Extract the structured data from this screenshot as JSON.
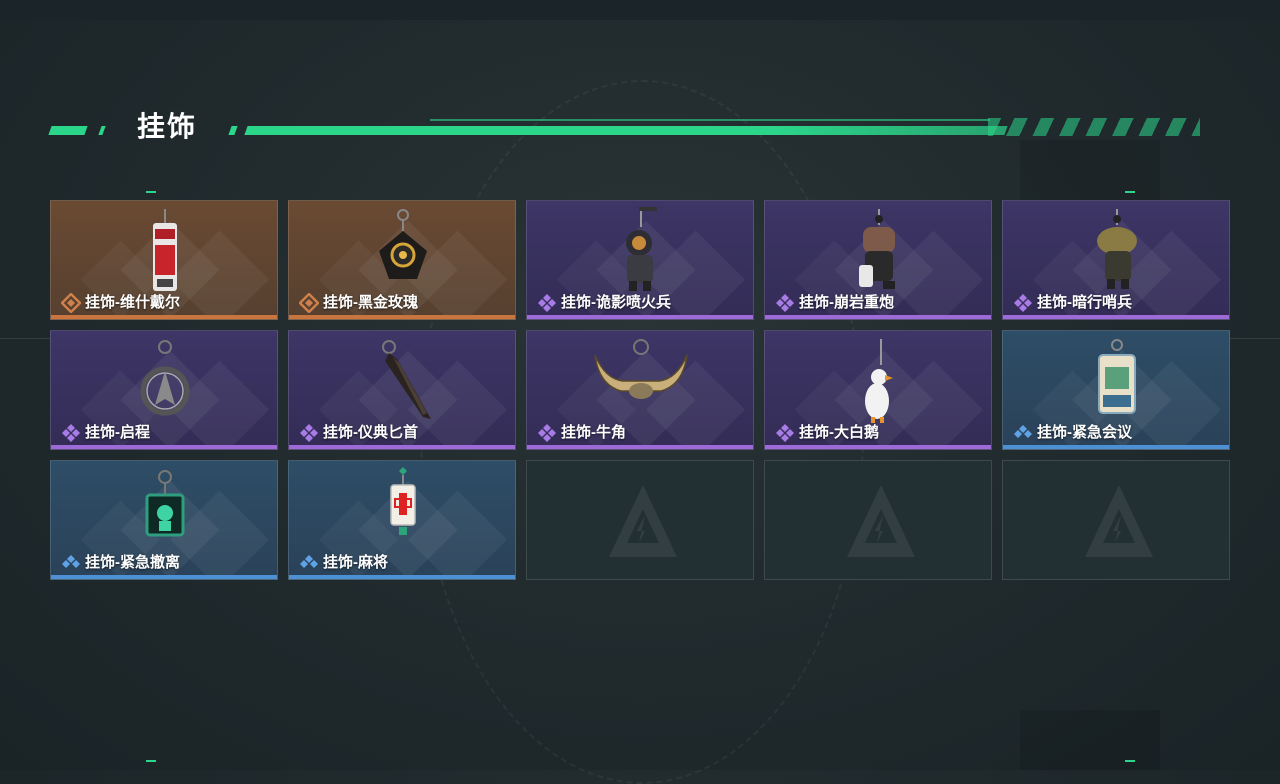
{
  "section": {
    "title": "挂饰"
  },
  "colors": {
    "accent": "#2bd58a",
    "orange_rarity": "#c9753f",
    "purple_rarity": "#9d6ad8",
    "blue_rarity": "#4d90d4"
  },
  "items": [
    {
      "label": "挂饰-维什戴尔",
      "rarity": "orange",
      "icon": "red-tag-charm-icon"
    },
    {
      "label": "挂饰-黑金玫瑰",
      "rarity": "orange",
      "icon": "black-gold-rose-charm-icon"
    },
    {
      "label": "挂饰-诡影喷火兵",
      "rarity": "purple",
      "icon": "flamethrower-figure-charm-icon"
    },
    {
      "label": "挂饰-崩岩重炮",
      "rarity": "purple",
      "icon": "heavy-gunner-figure-charm-icon"
    },
    {
      "label": "挂饰-暗行哨兵",
      "rarity": "purple",
      "icon": "sentry-figure-charm-icon"
    },
    {
      "label": "挂饰-启程",
      "rarity": "purple",
      "icon": "compass-ring-charm-icon"
    },
    {
      "label": "挂饰-仪典匕首",
      "rarity": "purple",
      "icon": "dagger-charm-icon"
    },
    {
      "label": "挂饰-牛角",
      "rarity": "purple",
      "icon": "bull-horns-charm-icon"
    },
    {
      "label": "挂饰-大白鹅",
      "rarity": "purple",
      "icon": "white-goose-charm-icon"
    },
    {
      "label": "挂饰-紧急会议",
      "rarity": "blue",
      "icon": "emergency-meeting-charm-icon"
    },
    {
      "label": "挂饰-紧急撤离",
      "rarity": "blue",
      "icon": "emergency-exit-charm-icon"
    },
    {
      "label": "挂饰-麻将",
      "rarity": "blue",
      "icon": "mahjong-tile-charm-icon"
    },
    {
      "label": "",
      "rarity": "empty",
      "icon": "empty-slot-logo-icon"
    },
    {
      "label": "",
      "rarity": "empty",
      "icon": "empty-slot-logo-icon"
    },
    {
      "label": "",
      "rarity": "empty",
      "icon": "empty-slot-logo-icon"
    }
  ]
}
